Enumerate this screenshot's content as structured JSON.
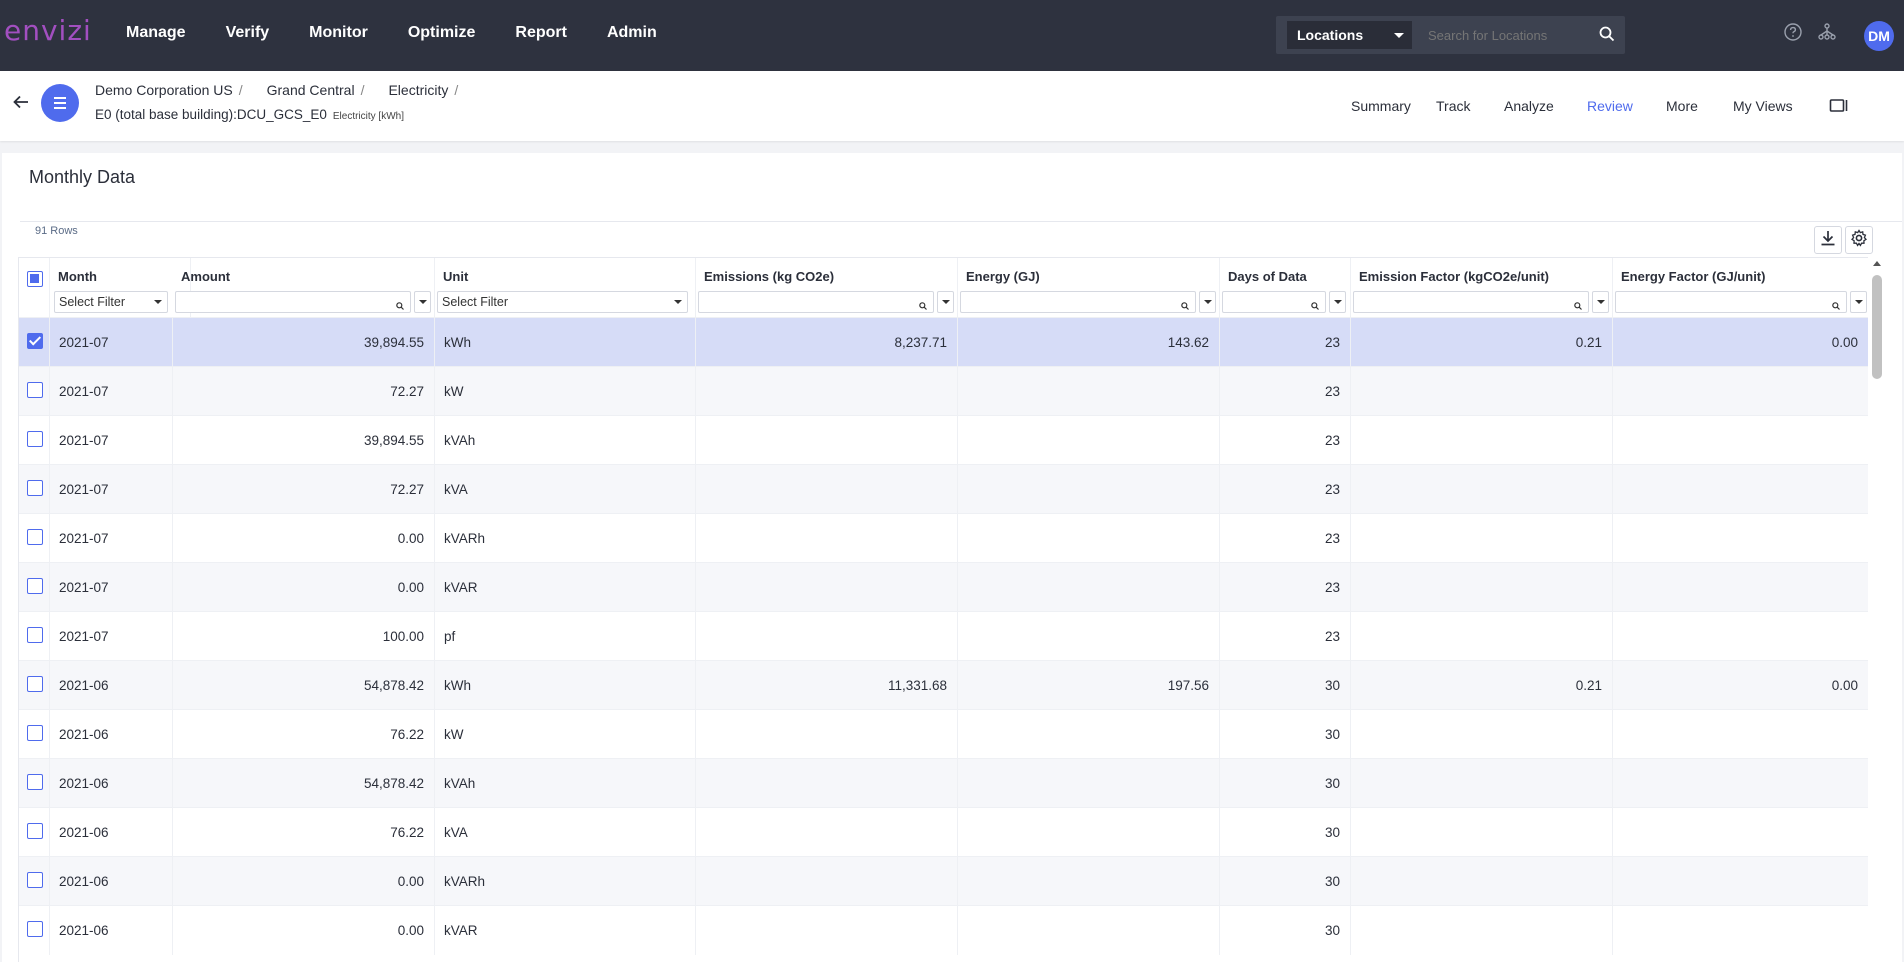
{
  "app": {
    "logo": "envizi",
    "nav": [
      "Manage",
      "Verify",
      "Monitor",
      "Optimize",
      "Report",
      "Admin"
    ],
    "location_selector": "Locations",
    "search_placeholder": "Search for Locations",
    "user_initials": "DM"
  },
  "header": {
    "breadcrumbs": [
      "Demo Corporation US",
      "Grand Central",
      "Electricity"
    ],
    "title": "E0 (total base building):DCU_GCS_E0",
    "subtitle": "Electricity [kWh]",
    "tabs": [
      "Summary",
      "Track",
      "Analyze",
      "Review",
      "More",
      "My Views"
    ],
    "active_tab": "Review"
  },
  "card": {
    "title": "Monthly Data",
    "row_count": "91 Rows"
  },
  "table": {
    "columns": [
      "Month",
      "Amount",
      "Unit",
      "Emissions (kg CO2e)",
      "Energy (GJ)",
      "Days of Data",
      "Emission Factor (kgCO2e/unit)",
      "Energy Factor (GJ/unit)"
    ],
    "filter_placeholder": "Select Filter",
    "rows": [
      {
        "month": "2021-07",
        "amount": "39,894.55",
        "unit": "kWh",
        "emissions": "8,237.71",
        "energy": "143.62",
        "days": "23",
        "ef": "0.21",
        "enf": "0.00",
        "checked": true
      },
      {
        "month": "2021-07",
        "amount": "72.27",
        "unit": "kW",
        "emissions": "",
        "energy": "",
        "days": "23",
        "ef": "",
        "enf": "",
        "checked": false
      },
      {
        "month": "2021-07",
        "amount": "39,894.55",
        "unit": "kVAh",
        "emissions": "",
        "energy": "",
        "days": "23",
        "ef": "",
        "enf": "",
        "checked": false
      },
      {
        "month": "2021-07",
        "amount": "72.27",
        "unit": "kVA",
        "emissions": "",
        "energy": "",
        "days": "23",
        "ef": "",
        "enf": "",
        "checked": false
      },
      {
        "month": "2021-07",
        "amount": "0.00",
        "unit": "kVARh",
        "emissions": "",
        "energy": "",
        "days": "23",
        "ef": "",
        "enf": "",
        "checked": false
      },
      {
        "month": "2021-07",
        "amount": "0.00",
        "unit": "kVAR",
        "emissions": "",
        "energy": "",
        "days": "23",
        "ef": "",
        "enf": "",
        "checked": false
      },
      {
        "month": "2021-07",
        "amount": "100.00",
        "unit": "pf",
        "emissions": "",
        "energy": "",
        "days": "23",
        "ef": "",
        "enf": "",
        "checked": false
      },
      {
        "month": "2021-06",
        "amount": "54,878.42",
        "unit": "kWh",
        "emissions": "11,331.68",
        "energy": "197.56",
        "days": "30",
        "ef": "0.21",
        "enf": "0.00",
        "checked": false
      },
      {
        "month": "2021-06",
        "amount": "76.22",
        "unit": "kW",
        "emissions": "",
        "energy": "",
        "days": "30",
        "ef": "",
        "enf": "",
        "checked": false
      },
      {
        "month": "2021-06",
        "amount": "54,878.42",
        "unit": "kVAh",
        "emissions": "",
        "energy": "",
        "days": "30",
        "ef": "",
        "enf": "",
        "checked": false
      },
      {
        "month": "2021-06",
        "amount": "76.22",
        "unit": "kVA",
        "emissions": "",
        "energy": "",
        "days": "30",
        "ef": "",
        "enf": "",
        "checked": false
      },
      {
        "month": "2021-06",
        "amount": "0.00",
        "unit": "kVARh",
        "emissions": "",
        "energy": "",
        "days": "30",
        "ef": "",
        "enf": "",
        "checked": false
      },
      {
        "month": "2021-06",
        "amount": "0.00",
        "unit": "kVAR",
        "emissions": "",
        "energy": "",
        "days": "30",
        "ef": "",
        "enf": "",
        "checked": false
      }
    ]
  },
  "colors": {
    "topbar": "#2e323f",
    "accent": "#4f6bed",
    "logo": "#a24fc0",
    "selected_row": "#d6dcf7"
  }
}
